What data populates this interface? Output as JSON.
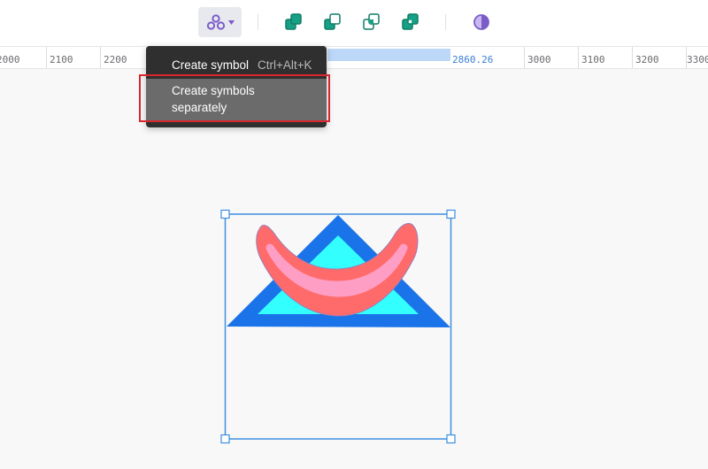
{
  "toolbar": {
    "icons": [
      "symbol-icon",
      "union-icon",
      "subtract-icon",
      "intersect-icon",
      "exclude-icon",
      "mask-icon"
    ]
  },
  "ruler": {
    "labels": [
      "2000",
      "2100",
      "2200",
      "3000",
      "3100",
      "3200",
      "3300"
    ],
    "current_value": "2860.26"
  },
  "menu": {
    "item1_label": "Create symbol",
    "item1_shortcut": "Ctrl+Alt+K",
    "item2_label": "Create symbols separately"
  },
  "colors": {
    "accent": "#7b5cc9",
    "boolean_icons": "#16a085",
    "selection": "#3d8ee0",
    "triangle_outer": "#1a73e8",
    "triangle_inner": "#33ffff",
    "crescent_outer": "#ff6b6b",
    "crescent_inner": "#ff9ec4",
    "annotation": "#d9272e"
  }
}
